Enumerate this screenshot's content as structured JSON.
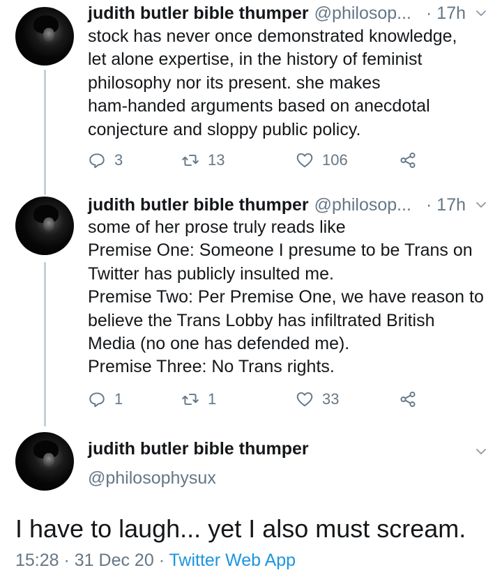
{
  "tweets": [
    {
      "name": "judith butler bible thumper",
      "handle": "@philosop...",
      "time": "· 17h",
      "lines": [
        "stock has never once demonstrated knowledge,",
        "let alone expertise, in the history of feminist",
        "philosophy nor its present. she makes",
        "ham-handed arguments based on anecdotal",
        "conjecture and sloppy public policy."
      ],
      "replies": "3",
      "retweets": "13",
      "likes": "106"
    },
    {
      "name": "judith butler bible thumper",
      "handle": "@philosop...",
      "time": "· 17h",
      "lines": [
        "some of her prose truly reads like",
        "Premise One: Someone I presume to be Trans on",
        "Twitter has publicly insulted me.",
        "Premise Two: Per Premise One, we have reason to",
        "believe the Trans Lobby has infiltrated British",
        "Media (no one has defended me).",
        "Premise Three: No Trans rights."
      ],
      "replies": "1",
      "retweets": "1",
      "likes": "33"
    }
  ],
  "main_tweet": {
    "name": "judith butler bible thumper",
    "handle": "@philosophysux",
    "text": "I have to laugh... yet I also must scream.",
    "timestamp": "15:28 · 31 Dec 20 · ",
    "source": "Twitter Web App"
  },
  "icons": {
    "reply": "reply-icon",
    "retweet": "retweet-icon",
    "like": "heart-icon",
    "share": "share-icon",
    "caret": "chevron-down-icon"
  },
  "colors": {
    "text": "#14171a",
    "secondary": "#657786",
    "link": "#1b95e0",
    "thread_line": "#c4cfd6"
  }
}
